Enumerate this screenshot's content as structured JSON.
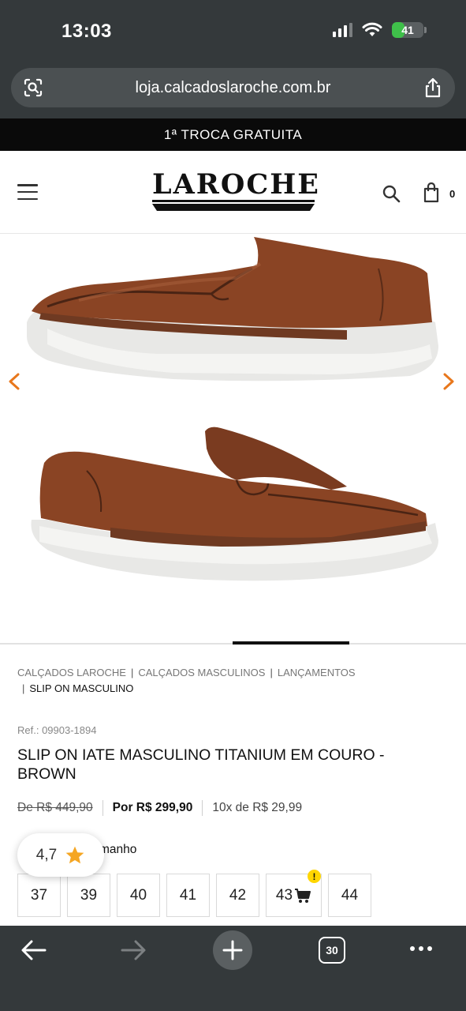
{
  "status": {
    "time": "13:03",
    "battery": "41",
    "battery_level": 0.41
  },
  "browser": {
    "url": "loja.calcadoslaroche.com.br",
    "tab_count": "30"
  },
  "promo": {
    "text": "1ª TROCA GRATUITA"
  },
  "header": {
    "logo": "LAROCHE",
    "cart_count": "0"
  },
  "breadcrumb": {
    "items": [
      "CALÇADOS LAROCHE",
      "CALÇADOS MASCULINOS",
      "LANÇAMENTOS"
    ],
    "current": "SLIP ON MASCULINO",
    "separator": "|"
  },
  "product": {
    "ref": "Ref.: 09903-1894",
    "title": "SLIP ON IATE MASCULINO TITANIUM EM COURO - BROWN",
    "price_old": "De R$ 449,90",
    "price_now": "Por R$ 299,90",
    "installments": "10x de R$ 29,99",
    "size_label": "manho",
    "sizes": [
      "37",
      "39",
      "40",
      "41",
      "42",
      "43",
      "44"
    ],
    "rating": "4,7"
  },
  "carousel": {
    "active_slide_fraction": 0.5
  },
  "colors": {
    "accent_arrow": "#e8771c",
    "chrome_bg": "#34393b",
    "star": "#f5a623",
    "alert": "#ffd600"
  },
  "icons": [
    "screen-search-icon",
    "share-icon",
    "menu-icon",
    "search-icon",
    "shopping-bag-icon",
    "chevron-left-icon",
    "chevron-right-icon",
    "star-icon",
    "cart-icon",
    "back-arrow-icon",
    "forward-arrow-icon",
    "plus-icon",
    "tabs-icon",
    "more-icon"
  ]
}
